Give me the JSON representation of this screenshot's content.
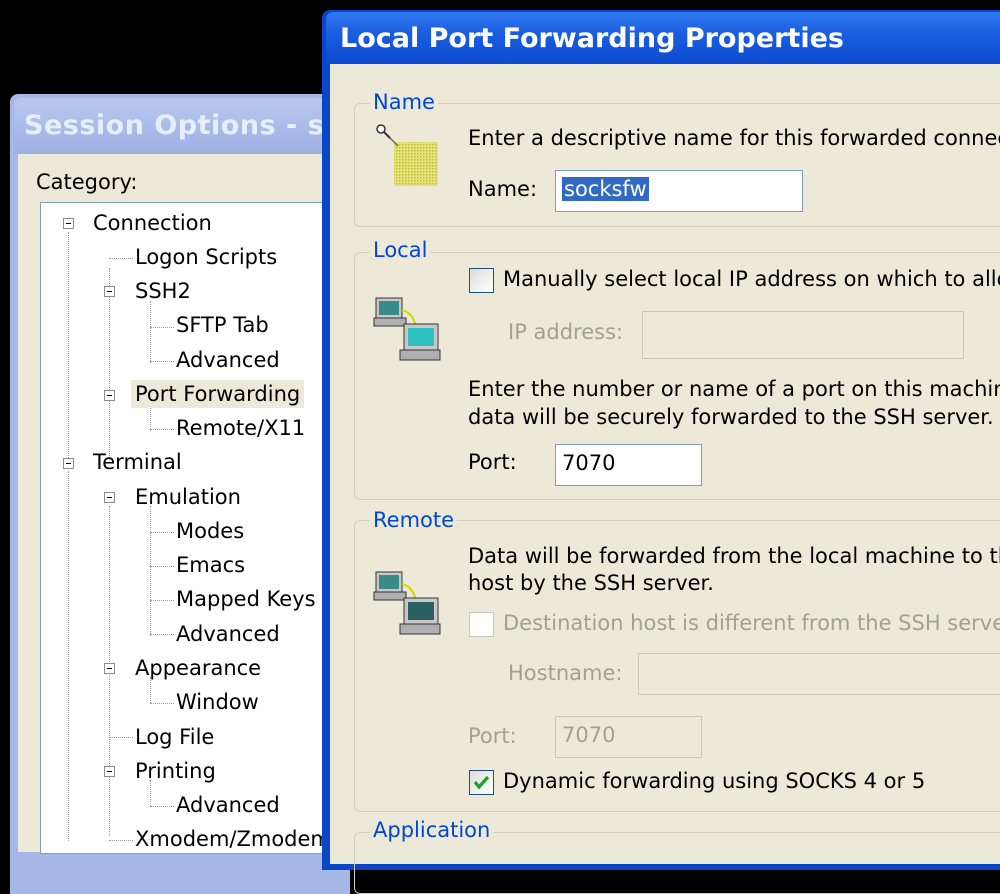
{
  "session": {
    "title": "Session Options - sv",
    "category_label": "Category:",
    "tree": [
      {
        "label": "Connection"
      },
      {
        "label": "Logon Scripts"
      },
      {
        "label": "SSH2"
      },
      {
        "label": "SFTP Tab"
      },
      {
        "label": "Advanced"
      },
      {
        "label": "Port Forwarding"
      },
      {
        "label": "Remote/X11"
      },
      {
        "label": "Terminal"
      },
      {
        "label": "Emulation"
      },
      {
        "label": "Modes"
      },
      {
        "label": "Emacs"
      },
      {
        "label": "Mapped Keys"
      },
      {
        "label": "Advanced"
      },
      {
        "label": "Appearance"
      },
      {
        "label": "Window"
      },
      {
        "label": "Log File"
      },
      {
        "label": "Printing"
      },
      {
        "label": "Advanced"
      },
      {
        "label": "Xmodem/Zmodem"
      }
    ]
  },
  "dialog": {
    "title": "Local Port Forwarding Properties",
    "name_group": {
      "legend": "Name",
      "description": "Enter a descriptive name for this forwarded connectio",
      "name_label": "Name:",
      "name_value": "socksfw"
    },
    "local_group": {
      "legend": "Local",
      "manual_checkbox_label": "Manually select local IP address on which to allow",
      "ip_label": "IP address:",
      "ip_value": "",
      "port_help_line1": "Enter the number or name of a port on this machine.",
      "port_help_line2": "data will be securely forwarded to the SSH server.",
      "port_label": "Port:",
      "port_value": "7070"
    },
    "remote_group": {
      "legend": "Remote",
      "help_line1": "Data will be forwarded from the local machine to the d",
      "help_line2": "host by the SSH server.",
      "dest_checkbox_label": "Destination host is different from the SSH server.",
      "hostname_label": "Hostname:",
      "hostname_value": "",
      "port_label": "Port:",
      "port_value": "7070",
      "dynamic_checkbox_label": "Dynamic forwarding using SOCKS 4 or 5",
      "dynamic_checked": true
    },
    "application_group": {
      "legend": "Application"
    }
  }
}
